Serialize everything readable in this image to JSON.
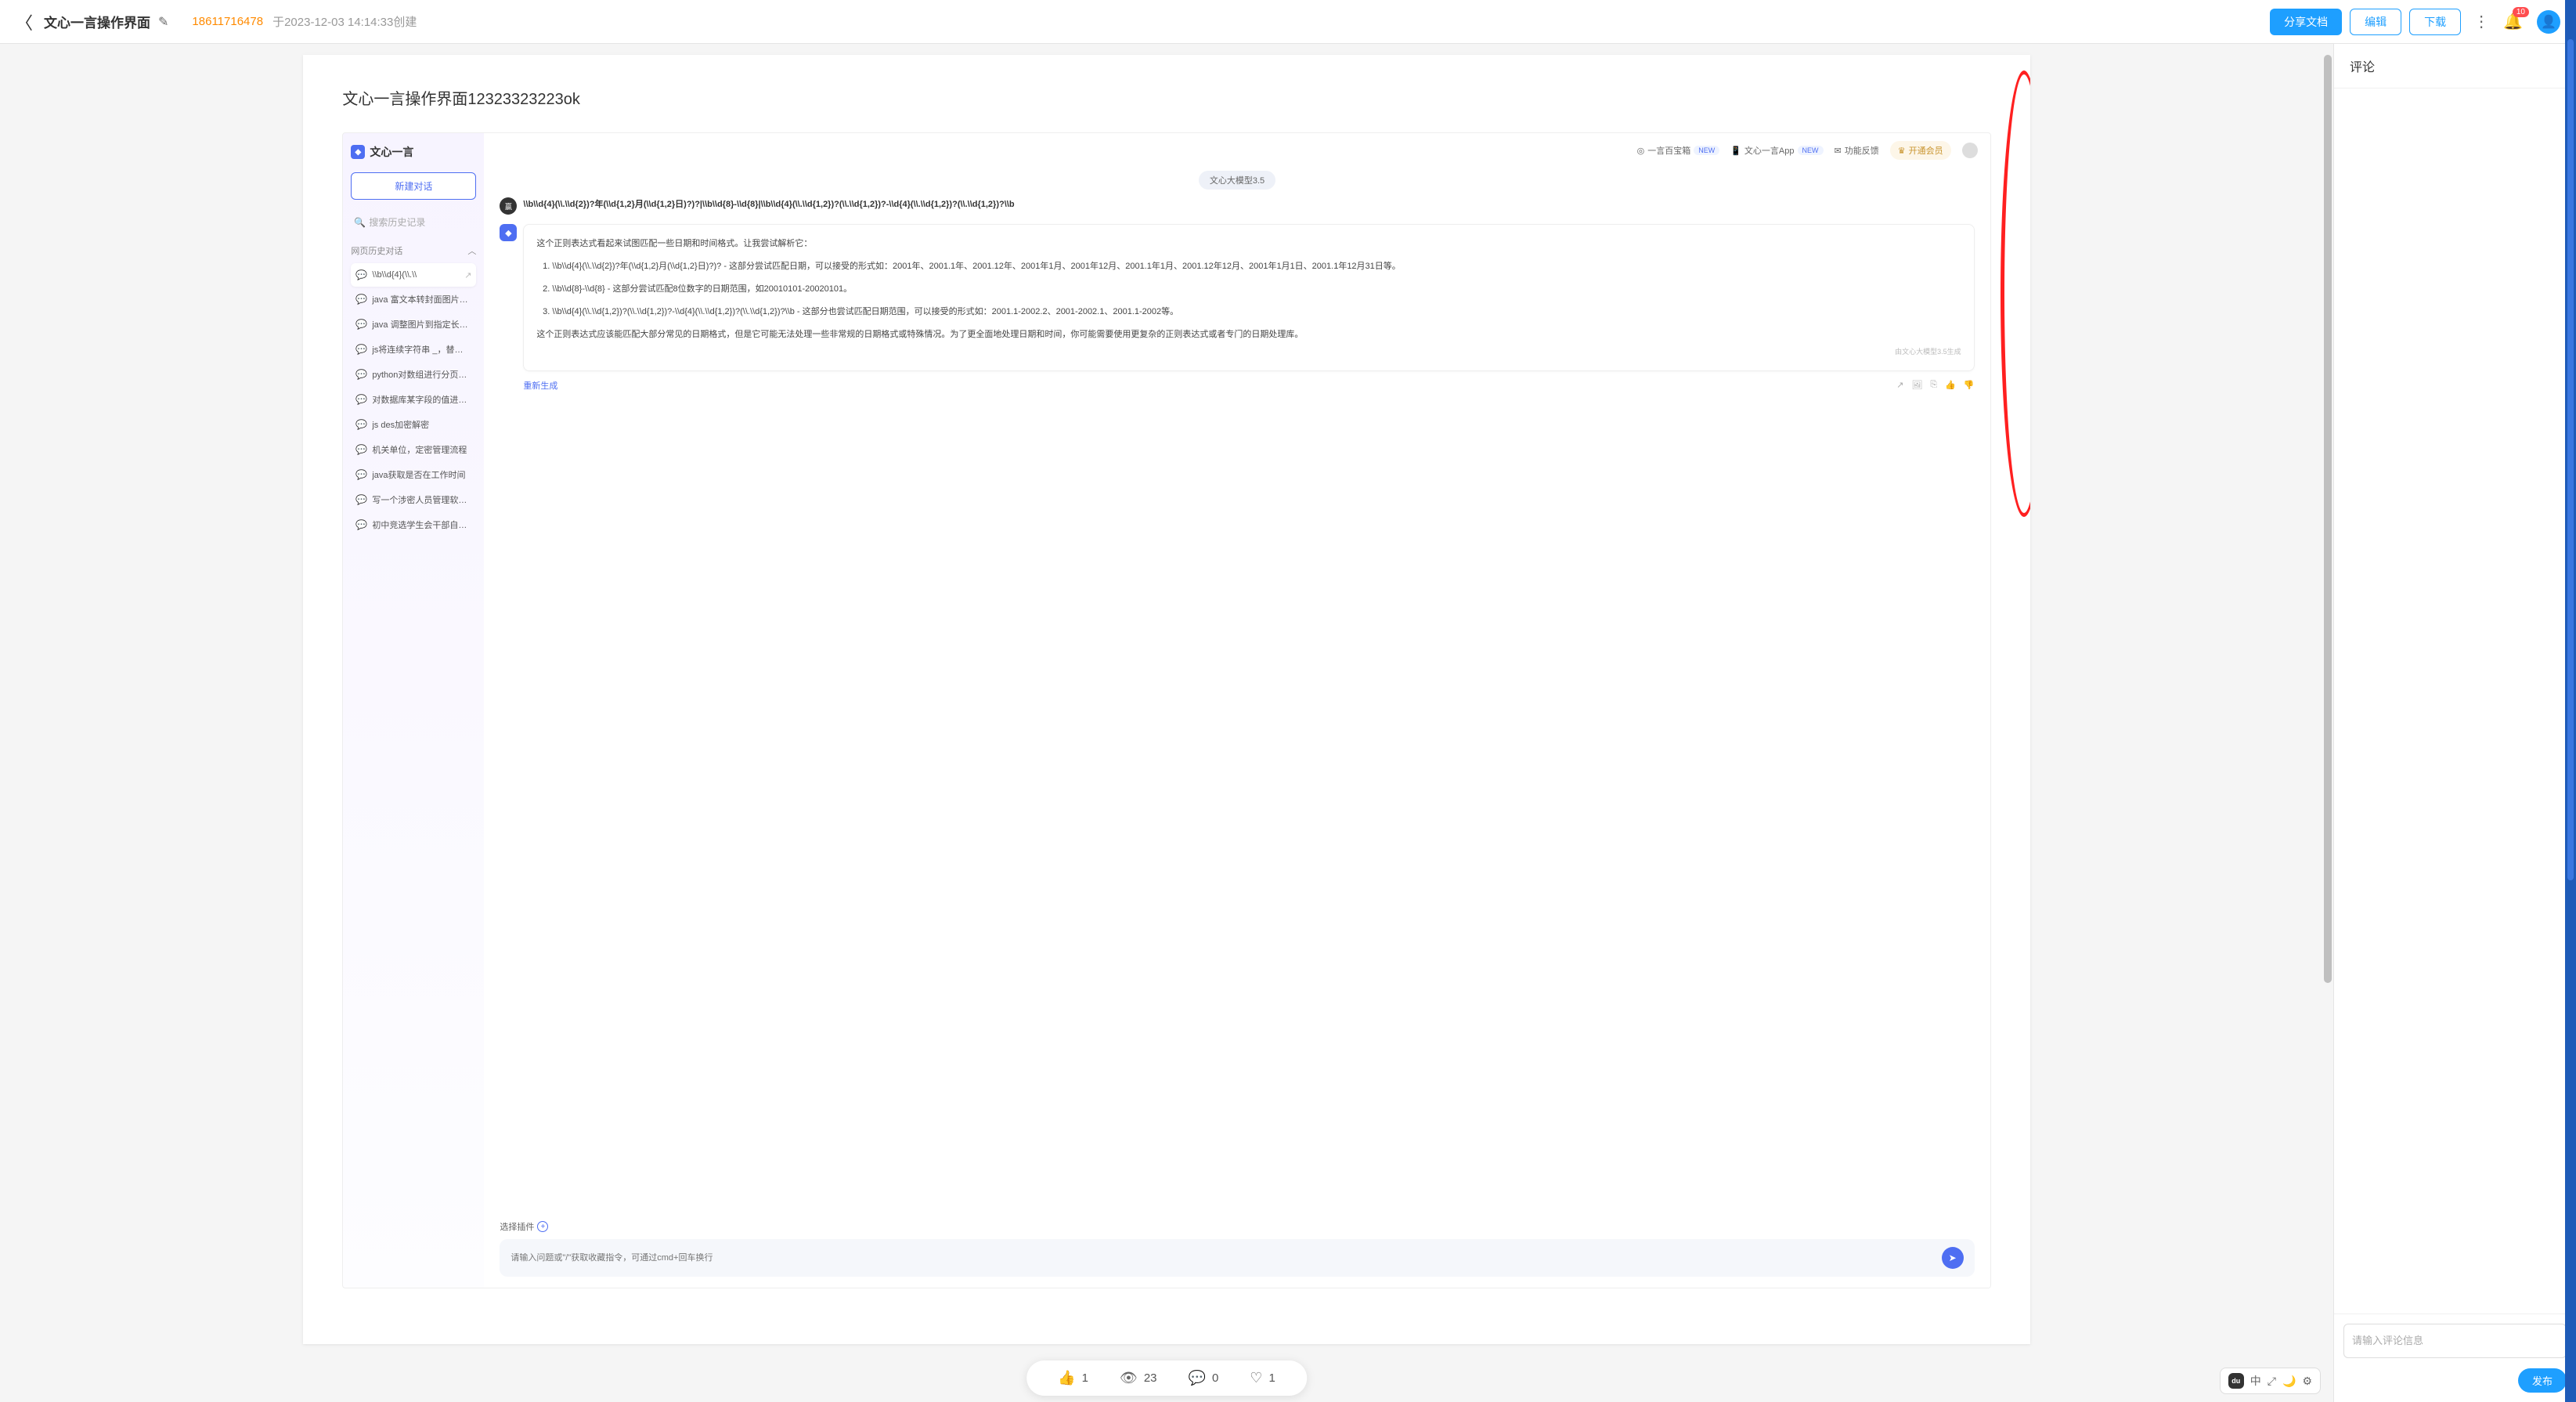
{
  "header": {
    "doc_title": "文心一言操作界面",
    "author": "18611716478",
    "created_meta": "于2023-12-03 14:14:33创建",
    "share_btn": "分享文档",
    "edit_btn": "编辑",
    "download_btn": "下载",
    "notification_count": "10"
  },
  "page": {
    "title": "文心一言操作界面12323323223ok"
  },
  "chat": {
    "brand": "文心一言",
    "new_chat": "新建对话",
    "search_placeholder": "搜索历史记录",
    "history_section": "网页历史对话",
    "history": [
      "\\\\b\\\\d{4}(\\\\.\\\\",
      "java 富文本转封面图片（缩",
      "java 调整图片到指定长宽，",
      "js将连续字符串 _，替换为",
      "python对数组进行分页处理",
      "对数据库某字段的值进行加密解密",
      "js des加密解密",
      "机关单位，定密管理流程",
      "java获取是否在工作时间",
      "写一个涉密人员管理软件设计文档",
      "初中竞选学生会干部自我介绍"
    ],
    "topbar": {
      "treasure": "一言百宝箱",
      "app": "文心一言App",
      "feedback": "功能反馈",
      "vip": "开通会员",
      "new_pill": "NEW"
    },
    "model_badge": "文心大模型3.5",
    "user_msg": "\\\\b\\\\d{4}(\\\\.\\\\d{2})?年(\\\\d{1,2}月(\\\\d{1,2}日)?)?|\\\\b\\\\d{8}-\\\\d{8}|\\\\b\\\\d{4}(\\\\.\\\\d{1,2})?(\\\\.\\\\d{1,2})?-\\\\d{4}(\\\\.\\\\d{1,2})?(\\\\.\\\\d{1,2})?\\\\b",
    "bot_intro": "这个正则表达式看起来试图匹配一些日期和时间格式。让我尝试解析它：",
    "bot_items": [
      "\\\\b\\\\d{4}(\\\\.\\\\d{2})?年(\\\\d{1,2}月(\\\\d{1,2}日)?)? - 这部分尝试匹配日期，可以接受的形式如：2001年、2001.1年、2001.12年、2001年1月、2001年12月、2001.1年1月、2001.12年12月、2001年1月1日、2001.1年12月31日等。",
      "\\\\b\\\\d{8}-\\\\d{8} - 这部分尝试匹配8位数字的日期范围，如20010101-20020101。",
      "\\\\b\\\\d{4}(\\\\.\\\\d{1,2})?(\\\\.\\\\d{1,2})?-\\\\d{4}(\\\\.\\\\d{1,2})?(\\\\.\\\\d{1,2})?\\\\b - 这部分也尝试匹配日期范围，可以接受的形式如：2001.1-2002.2、2001-2002.1、2001.1-2002等。"
    ],
    "bot_outro": "这个正则表达式应该能匹配大部分常见的日期格式，但是它可能无法处理一些非常规的日期格式或特殊情况。为了更全面地处理日期和时间，你可能需要使用更复杂的正则表达式或者专门的日期处理库。",
    "gen_note": "由文心大模型3.5生成",
    "regen": "重新生成",
    "plugin_label": "选择插件",
    "input_placeholder": "请输入问题或\"/\"获取收藏指令，可通过cmd+回车换行"
  },
  "stats": {
    "like": "1",
    "view": "23",
    "comment": "0",
    "fav": "1"
  },
  "widgets": {
    "lang": "中",
    "logo": "du"
  },
  "comment_panel": {
    "title": "评论",
    "placeholder": "请输入评论信息",
    "publish": "发布"
  }
}
